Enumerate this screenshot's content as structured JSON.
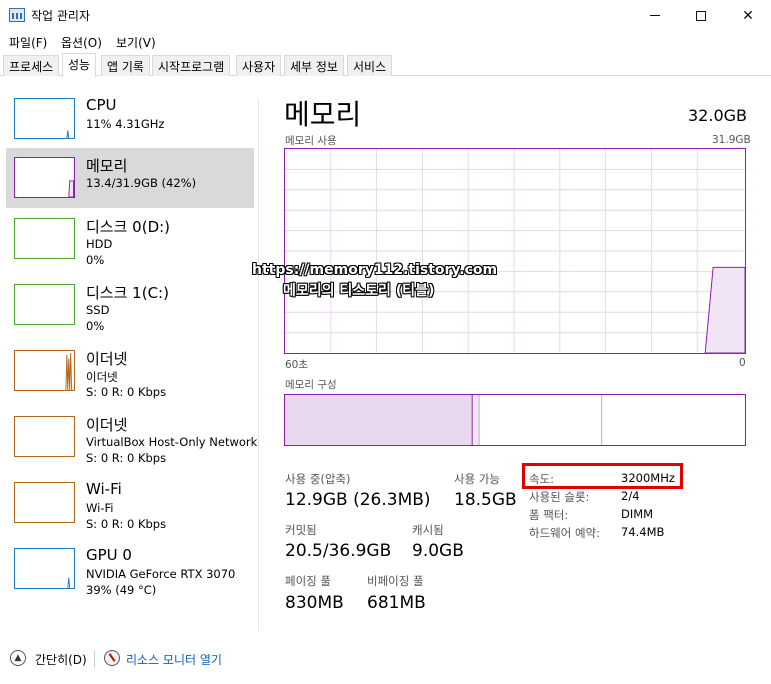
{
  "window": {
    "title": "작업 관리자"
  },
  "menu": [
    "파일(F)",
    "옵션(O)",
    "보기(V)"
  ],
  "tabs": [
    "프로세스",
    "성능",
    "앱 기록",
    "시작프로그램",
    "사용자",
    "세부 정보",
    "서비스"
  ],
  "active_tab": "성능",
  "sidebar": [
    {
      "title": "CPU",
      "line1": "11% 4.31GHz",
      "line2": "",
      "color": "#1f7bbf"
    },
    {
      "title": "메모리",
      "line1": "13.4/31.9GB (42%)",
      "line2": "",
      "color": "#8a1fb1"
    },
    {
      "title": "디스크 0(D:)",
      "line1": "HDD",
      "line2": "0%",
      "color": "#4da62e"
    },
    {
      "title": "디스크 1(C:)",
      "line1": "SSD",
      "line2": "0%",
      "color": "#4da62e"
    },
    {
      "title": "이더넷",
      "line1": "이더넷",
      "line2": "S: 0 R: 0 Kbps",
      "color": "#b3661a"
    },
    {
      "title": "이더넷",
      "line1": "VirtualBox Host-Only Network",
      "line2": "S: 0 R: 0 Kbps",
      "color": "#b3661a"
    },
    {
      "title": "Wi-Fi",
      "line1": "Wi-Fi",
      "line2": "S: 0 R: 0 Kbps",
      "color": "#b3661a"
    },
    {
      "title": "GPU 0",
      "line1": "NVIDIA GeForce RTX 3070",
      "line2": "39% (49 °C)",
      "color": "#1f7bbf"
    }
  ],
  "memory": {
    "title": "메모리",
    "total": "32.0GB",
    "usage_label": "메모리 사용",
    "usage_max": "31.9GB",
    "time_left": "60초",
    "time_right": "0",
    "composition_label": "메모리 구성",
    "usage_level": 0.42,
    "stats": {
      "in_use_label": "사용 중(압축)",
      "in_use_value": "12.9GB (26.3MB)",
      "available_label": "사용 가능",
      "available_value": "18.5GB",
      "committed_label": "커밋됨",
      "committed_value": "20.5/36.9GB",
      "cached_label": "캐시됨",
      "cached_value": "9.0GB",
      "paged_label": "페이징 풀",
      "paged_value": "830MB",
      "nonpaged_label": "비페이징 풀",
      "nonpaged_value": "681MB"
    },
    "details": [
      {
        "label": "속도:",
        "value": "3200MHz"
      },
      {
        "label": "사용된 슬롯:",
        "value": "2/4"
      },
      {
        "label": "폼 팩터:",
        "value": "DIMM"
      },
      {
        "label": "하드웨어 예약:",
        "value": "74.4MB"
      }
    ]
  },
  "watermark": {
    "line1": "https://memory112.tistory.com",
    "line2": "메모리의 티스토리 (티블)"
  },
  "footer": {
    "fewer_details": "간단히(D)",
    "resource_monitor": "리소스 모니터 열기"
  }
}
